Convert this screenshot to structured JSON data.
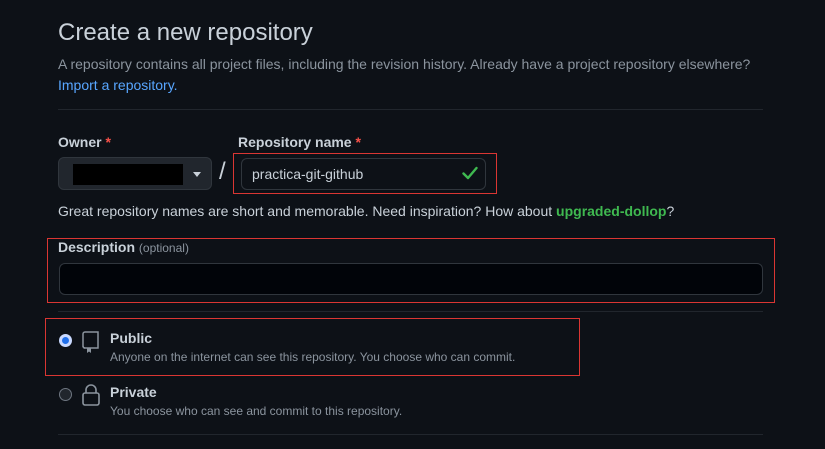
{
  "header": {
    "title": "Create a new repository",
    "subtitle": "A repository contains all project files, including the revision history. Already have a project repository elsewhere?",
    "import_link": "Import a repository."
  },
  "owner": {
    "label": "Owner",
    "required_mark": "*"
  },
  "repo_name": {
    "label": "Repository name",
    "required_mark": "*",
    "value": "practica-git-github",
    "separator": "/"
  },
  "hint": {
    "text": "Great repository names are short and memorable. Need inspiration? How about ",
    "suggestion": "upgraded-dollop",
    "suffix": "?"
  },
  "description": {
    "label": "Description",
    "optional": "(optional)",
    "value": ""
  },
  "visibility": {
    "public": {
      "label": "Public",
      "desc": "Anyone on the internet can see this repository. You choose who can commit.",
      "selected": true,
      "icon": "repo-icon"
    },
    "private": {
      "label": "Private",
      "desc": "You choose who can see and commit to this repository.",
      "selected": false,
      "icon": "lock-icon"
    }
  },
  "colors": {
    "background": "#0d1117",
    "link": "#58a6ff",
    "success": "#3fb950",
    "required": "#f85149",
    "highlight": "#da3633"
  }
}
